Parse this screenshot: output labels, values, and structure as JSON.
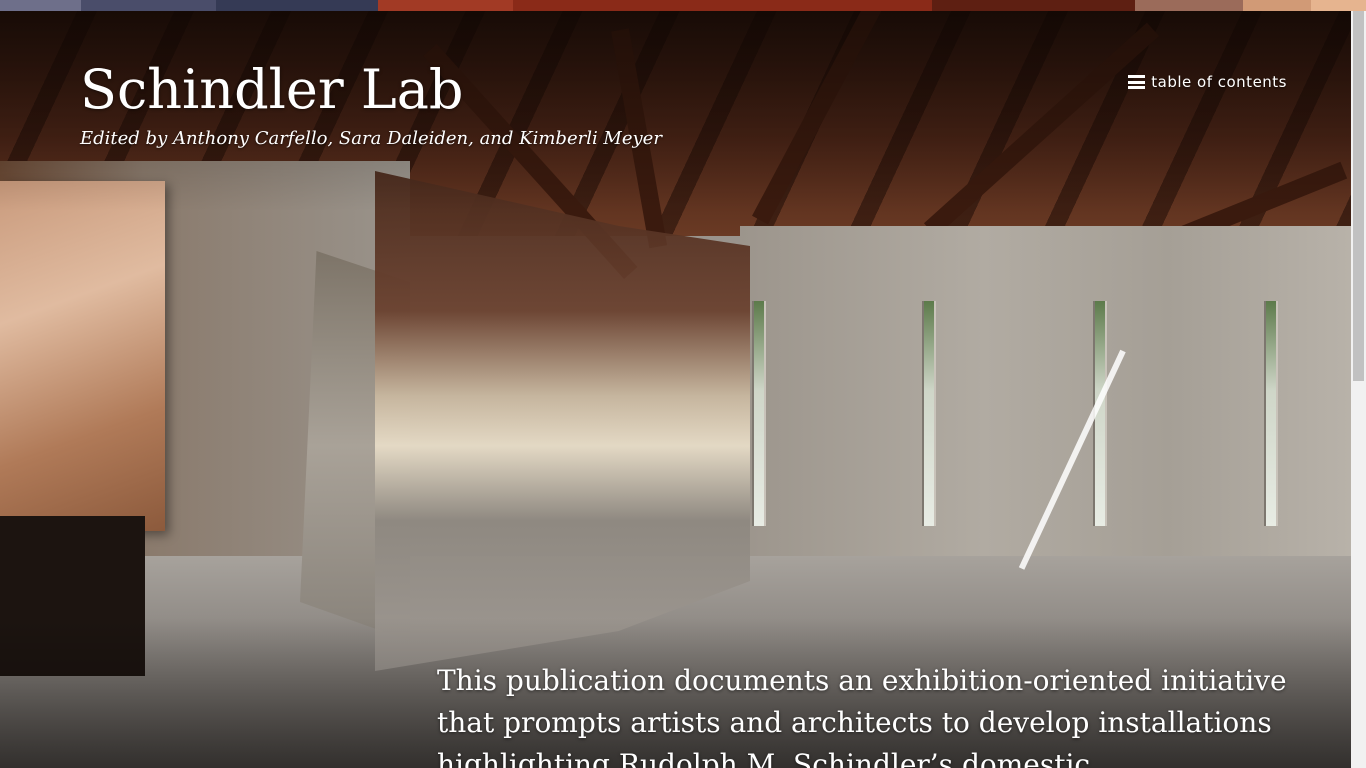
{
  "header": {
    "title": "Schindler Lab",
    "subtitle": "Edited by Anthony Carfello, Sara Daleiden, and Kimberli Meyer",
    "toc_label": "table of contents",
    "toc_icon": "hamburger-menu-icon"
  },
  "intro": {
    "text": "This publication documents an exhibition-oriented initiative that prompts artists and architects to develop installations highlighting Rudolph M. Schindler’s domestic"
  },
  "hero": {
    "image_description_icon": "hero-photo"
  },
  "stripe": {
    "colors": [
      "#6e6f8a",
      "#4a4d6a",
      "#353a55",
      "#a23a25",
      "#8a2a18",
      "#8a2a18",
      "#5e1f12",
      "#9b6b5a",
      "#d19a76",
      "#e6b48f"
    ]
  }
}
